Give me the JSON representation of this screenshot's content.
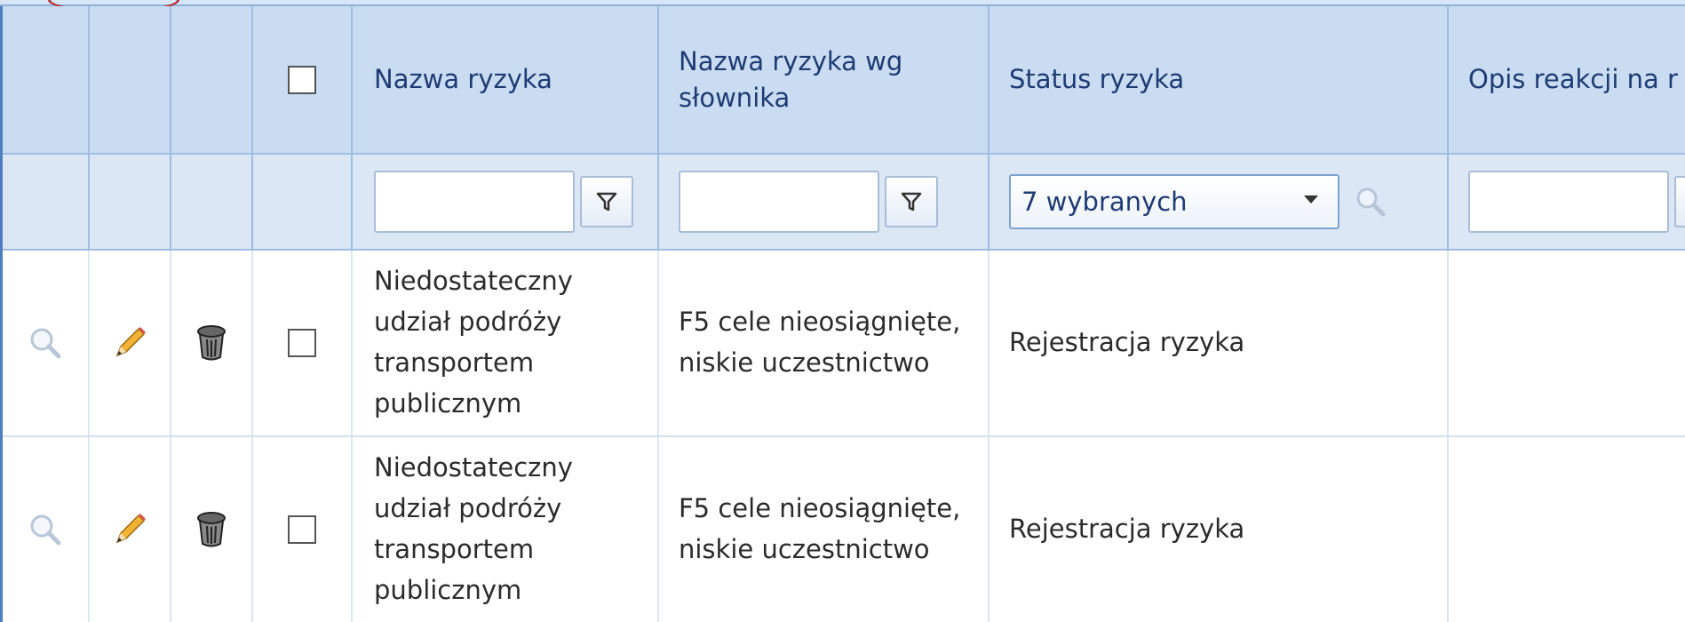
{
  "grid": {
    "columns": {
      "checkbox": "",
      "risk_name": "Nazwa ryzyka",
      "risk_name_dict": "Nazwa ryzyka wg słownika",
      "risk_status": "Status ryzyka",
      "response_desc": "Opis reakcji na r"
    },
    "filters": {
      "risk_name_value": "",
      "risk_name_dict_value": "",
      "risk_status_selected": "7 wybranych",
      "response_desc_value": ""
    },
    "rows": [
      {
        "risk_name": "Niedostateczny udział podróży transportem publicznym",
        "risk_name_dict": "F5 cele nieosiągnięte, niskie uczestnictwo",
        "risk_status": "Rejestracja ryzyka",
        "response_desc": ""
      },
      {
        "risk_name": "Niedostateczny udział podróży transportem publicznym",
        "risk_name_dict": "F5 cele nieosiągnięte, niskie uczestnictwo",
        "risk_status": "Rejestracja ryzyka",
        "response_desc": ""
      }
    ]
  },
  "icons": {
    "view": "magnifier-icon",
    "edit": "pencil-icon",
    "delete": "trash-icon",
    "filter": "funnel-icon",
    "search": "search-icon"
  },
  "colors": {
    "header_bg": "#c9dcf2",
    "filter_bg": "#dbe7f5",
    "accent_border": "#4d7fbf",
    "highlight_circle": "#b5323a"
  }
}
